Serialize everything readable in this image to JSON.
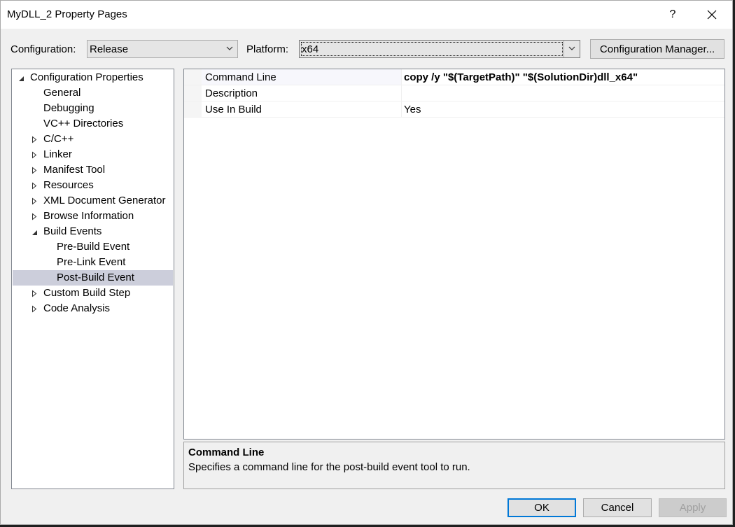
{
  "window": {
    "title": "MyDLL_2 Property Pages",
    "help_label": "?"
  },
  "config": {
    "label": "Configuration:",
    "value": "Release"
  },
  "platform": {
    "label": "Platform:",
    "value": "x64"
  },
  "config_manager_label": "Configuration Manager...",
  "tree": {
    "items": [
      {
        "label": "Configuration Properties",
        "expander": "expanded"
      },
      {
        "label": "General",
        "expander": "none"
      },
      {
        "label": "Debugging",
        "expander": "none"
      },
      {
        "label": "VC++ Directories",
        "expander": "none"
      },
      {
        "label": "C/C++",
        "expander": "collapsed"
      },
      {
        "label": "Linker",
        "expander": "collapsed"
      },
      {
        "label": "Manifest Tool",
        "expander": "collapsed"
      },
      {
        "label": "Resources",
        "expander": "collapsed"
      },
      {
        "label": "XML Document Generator",
        "expander": "collapsed"
      },
      {
        "label": "Browse Information",
        "expander": "collapsed"
      },
      {
        "label": "Build Events",
        "expander": "expanded"
      },
      {
        "label": "Pre-Build Event",
        "expander": "none"
      },
      {
        "label": "Pre-Link Event",
        "expander": "none"
      },
      {
        "label": "Post-Build Event",
        "expander": "none",
        "selected": true
      },
      {
        "label": "Custom Build Step",
        "expander": "collapsed"
      },
      {
        "label": "Code Analysis",
        "expander": "collapsed"
      }
    ]
  },
  "properties": [
    {
      "name": "Command Line",
      "value": "copy /y \"$(TargetPath)\" \"$(SolutionDir)dll_x64\"",
      "bold": true
    },
    {
      "name": "Description",
      "value": ""
    },
    {
      "name": "Use In Build",
      "value": "Yes"
    }
  ],
  "description": {
    "title": "Command Line",
    "text": "Specifies a command line for the post-build event tool to run."
  },
  "buttons": {
    "ok": "OK",
    "cancel": "Cancel",
    "apply": "Apply"
  },
  "colors": {
    "selection": "#cccedb",
    "focus_border": "#0078d7"
  }
}
